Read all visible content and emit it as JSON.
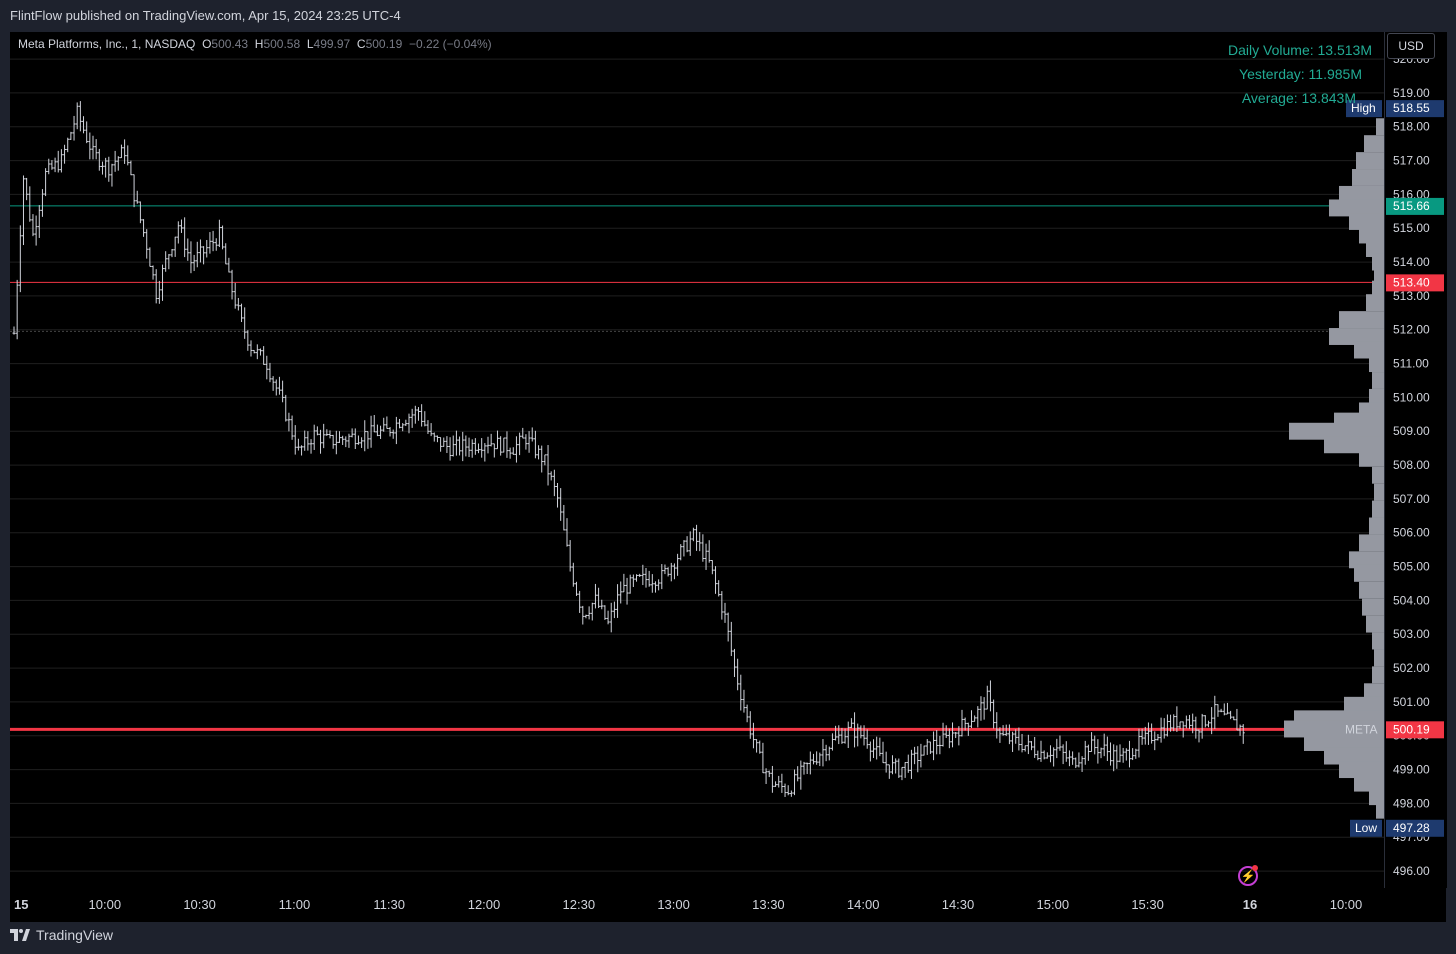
{
  "header": {
    "published": "FlintFlow published on TradingView.com, Apr 15, 2024 23:25 UTC-4"
  },
  "legend": {
    "symbol": "Meta Platforms, Inc., 1, NASDAQ",
    "o_label": "O",
    "o": "500.43",
    "h_label": "H",
    "h": "500.58",
    "l_label": "L",
    "l": "499.97",
    "c_label": "C",
    "c": "500.19",
    "change": "−0.22 (−0.04%)"
  },
  "currency_button": "USD",
  "volume_info": {
    "daily": "Daily Volume: 13.513M",
    "yesterday": "Yesterday: 11.985M",
    "average": "Average: 13.843M"
  },
  "footer": {
    "brand": "TradingView"
  },
  "colors": {
    "background": "#000000",
    "frame": "#1e222d",
    "bar": "#d1d4dc",
    "red_line": "#f23645",
    "green_line": "#089981",
    "volume_text": "#22ab94",
    "label_blue": "#1e3a6e",
    "profile": "#9598a1"
  },
  "chart_data": {
    "type": "bar",
    "title": "Meta Platforms, Inc., 1, NASDAQ",
    "interval": "1 minute",
    "ylim": [
      495.5,
      520.8
    ],
    "y_ticks": [
      "496.00",
      "497.00",
      "498.00",
      "499.00",
      "500.00",
      "501.00",
      "502.00",
      "503.00",
      "504.00",
      "505.00",
      "506.00",
      "507.00",
      "508.00",
      "509.00",
      "510.00",
      "511.00",
      "512.00",
      "513.00",
      "514.00",
      "515.00",
      "516.00",
      "517.00",
      "518.00",
      "519.00",
      "520.00"
    ],
    "x_ticks": [
      {
        "label": "15",
        "t": "09:30"
      },
      {
        "label": "10:00",
        "t": "10:00"
      },
      {
        "label": "10:30",
        "t": "10:30"
      },
      {
        "label": "11:00",
        "t": "11:00"
      },
      {
        "label": "11:30",
        "t": "11:30"
      },
      {
        "label": "12:00",
        "t": "12:00"
      },
      {
        "label": "12:30",
        "t": "12:30"
      },
      {
        "label": "13:00",
        "t": "13:00"
      },
      {
        "label": "13:30",
        "t": "13:30"
      },
      {
        "label": "14:00",
        "t": "14:00"
      },
      {
        "label": "14:30",
        "t": "14:30"
      },
      {
        "label": "15:00",
        "t": "15:00"
      },
      {
        "label": "15:30",
        "t": "15:30"
      },
      {
        "label": "16",
        "t": "16:00"
      },
      {
        "label": "10:00",
        "t": "next 10:00"
      }
    ],
    "price_path": [
      [
        "09:30",
        511.9
      ],
      [
        "09:33",
        516.5
      ],
      [
        "09:36",
        514.8
      ],
      [
        "09:40",
        516.6
      ],
      [
        "09:45",
        517.0
      ],
      [
        "09:50",
        518.4
      ],
      [
        "09:55",
        517.2
      ],
      [
        "10:00",
        516.8
      ],
      [
        "10:05",
        517.3
      ],
      [
        "10:08",
        516.0
      ],
      [
        "10:12",
        514.5
      ],
      [
        "10:15",
        513.1
      ],
      [
        "10:18",
        514.0
      ],
      [
        "10:22",
        515.1
      ],
      [
        "10:26",
        514.0
      ],
      [
        "10:30",
        514.3
      ],
      [
        "10:35",
        514.8
      ],
      [
        "10:38",
        513.5
      ],
      [
        "10:42",
        512.2
      ],
      [
        "10:45",
        511.5
      ],
      [
        "10:50",
        511.0
      ],
      [
        "10:55",
        509.8
      ],
      [
        "11:00",
        508.4
      ],
      [
        "11:05",
        508.9
      ],
      [
        "11:10",
        508.7
      ],
      [
        "11:20",
        508.9
      ],
      [
        "11:28",
        509.0
      ],
      [
        "11:32",
        509.3
      ],
      [
        "11:38",
        509.6
      ],
      [
        "11:42",
        508.8
      ],
      [
        "11:48",
        508.5
      ],
      [
        "11:55",
        508.6
      ],
      [
        "12:00",
        508.7
      ],
      [
        "12:08",
        508.5
      ],
      [
        "12:12",
        508.8
      ],
      [
        "12:18",
        508.1
      ],
      [
        "12:22",
        507.0
      ],
      [
        "12:26",
        505.0
      ],
      [
        "12:30",
        503.6
      ],
      [
        "12:34",
        504.0
      ],
      [
        "12:38",
        503.3
      ],
      [
        "12:42",
        504.3
      ],
      [
        "12:48",
        504.6
      ],
      [
        "12:55",
        504.7
      ],
      [
        "13:00",
        505.3
      ],
      [
        "13:05",
        505.9
      ],
      [
        "13:10",
        505.1
      ],
      [
        "13:15",
        503.5
      ],
      [
        "13:18",
        502.0
      ],
      [
        "13:22",
        500.5
      ],
      [
        "13:26",
        499.3
      ],
      [
        "13:30",
        498.6
      ],
      [
        "13:35",
        498.4
      ],
      [
        "13:40",
        499.0
      ],
      [
        "13:45",
        499.5
      ],
      [
        "13:50",
        499.9
      ],
      [
        "13:55",
        500.2
      ],
      [
        "14:00",
        499.9
      ],
      [
        "14:05",
        499.2
      ],
      [
        "14:10",
        499.0
      ],
      [
        "14:15",
        499.3
      ],
      [
        "14:20",
        499.7
      ],
      [
        "14:25",
        499.9
      ],
      [
        "14:30",
        500.3
      ],
      [
        "14:35",
        500.7
      ],
      [
        "14:38",
        501.1
      ],
      [
        "14:42",
        500.0
      ],
      [
        "14:48",
        499.8
      ],
      [
        "14:55",
        499.5
      ],
      [
        "15:00",
        499.6
      ],
      [
        "15:05",
        499.2
      ],
      [
        "15:10",
        499.7
      ],
      [
        "15:15",
        499.6
      ],
      [
        "15:20",
        499.3
      ],
      [
        "15:25",
        499.7
      ],
      [
        "15:30",
        500.0
      ],
      [
        "15:35",
        500.3
      ],
      [
        "15:40",
        500.5
      ],
      [
        "15:45",
        500.3
      ],
      [
        "15:50",
        500.7
      ],
      [
        "15:55",
        500.4
      ],
      [
        "15:59",
        500.19
      ]
    ],
    "horizontal_lines": [
      {
        "price": 515.66,
        "color": "#089981",
        "label": "515.66"
      },
      {
        "price": 513.4,
        "color": "#f23645",
        "label": "513.40"
      },
      {
        "price": 500.19,
        "color": "#f23645",
        "label": "500.19",
        "series": "META"
      }
    ],
    "high": {
      "label": "High",
      "value": "518.55"
    },
    "low": {
      "label": "Low",
      "value": "497.28"
    },
    "volume_profile": [
      [
        518.0,
        0.08
      ],
      [
        517.5,
        0.2
      ],
      [
        517.0,
        0.28
      ],
      [
        516.5,
        0.32
      ],
      [
        516.0,
        0.45
      ],
      [
        515.6,
        0.55
      ],
      [
        515.2,
        0.35
      ],
      [
        514.8,
        0.25
      ],
      [
        514.4,
        0.18
      ],
      [
        514.0,
        0.12
      ],
      [
        513.6,
        0.1
      ],
      [
        513.2,
        0.12
      ],
      [
        512.8,
        0.18
      ],
      [
        512.3,
        0.45
      ],
      [
        511.8,
        0.55
      ],
      [
        511.4,
        0.3
      ],
      [
        511.0,
        0.15
      ],
      [
        510.5,
        0.12
      ],
      [
        510.0,
        0.15
      ],
      [
        509.6,
        0.25
      ],
      [
        509.3,
        0.5
      ],
      [
        509.0,
        0.95
      ],
      [
        508.6,
        0.6
      ],
      [
        508.2,
        0.25
      ],
      [
        507.7,
        0.12
      ],
      [
        507.2,
        0.1
      ],
      [
        506.7,
        0.12
      ],
      [
        506.2,
        0.15
      ],
      [
        505.7,
        0.25
      ],
      [
        505.2,
        0.35
      ],
      [
        504.8,
        0.3
      ],
      [
        504.3,
        0.25
      ],
      [
        503.8,
        0.22
      ],
      [
        503.3,
        0.18
      ],
      [
        502.8,
        0.12
      ],
      [
        502.3,
        0.1
      ],
      [
        501.8,
        0.12
      ],
      [
        501.3,
        0.2
      ],
      [
        500.9,
        0.4
      ],
      [
        500.5,
        0.9
      ],
      [
        500.2,
        1.0
      ],
      [
        499.8,
        0.8
      ],
      [
        499.4,
        0.6
      ],
      [
        499.0,
        0.45
      ],
      [
        498.6,
        0.3
      ],
      [
        498.2,
        0.15
      ],
      [
        497.8,
        0.08
      ]
    ]
  }
}
